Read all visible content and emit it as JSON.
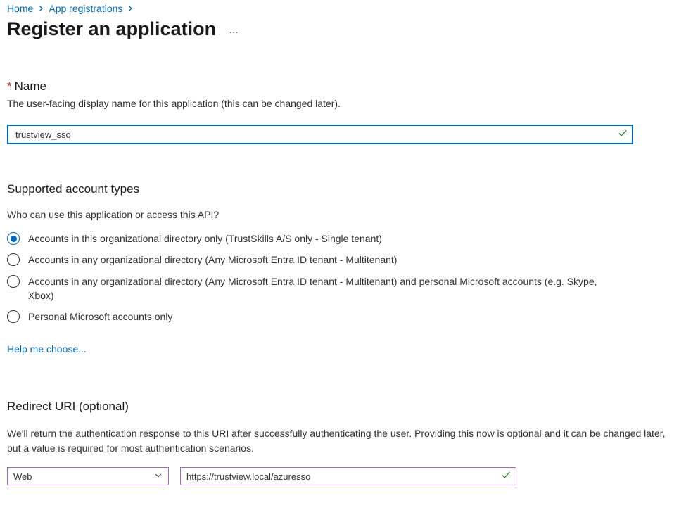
{
  "breadcrumb": {
    "home": "Home",
    "app_registrations": "App registrations"
  },
  "header": {
    "title": "Register an application"
  },
  "name_field": {
    "label": "Name",
    "description": "The user-facing display name for this application (this can be changed later).",
    "value": "trustview_sso"
  },
  "account_types": {
    "header": "Supported account types",
    "description": "Who can use this application or access this API?",
    "options": [
      "Accounts in this organizational directory only (TrustSkills A/S only - Single tenant)",
      "Accounts in any organizational directory (Any Microsoft Entra ID tenant - Multitenant)",
      "Accounts in any organizational directory (Any Microsoft Entra ID tenant - Multitenant) and personal Microsoft accounts (e.g. Skype, Xbox)",
      "Personal Microsoft accounts only"
    ],
    "selected_index": 0,
    "help_link": "Help me choose..."
  },
  "redirect_uri": {
    "header": "Redirect URI (optional)",
    "description": "We'll return the authentication response to this URI after successfully authenticating the user. Providing this now is optional and it can be changed later, but a value is required for most authentication scenarios.",
    "platform": "Web",
    "uri_value": "https://trustview.local/azuresso"
  }
}
